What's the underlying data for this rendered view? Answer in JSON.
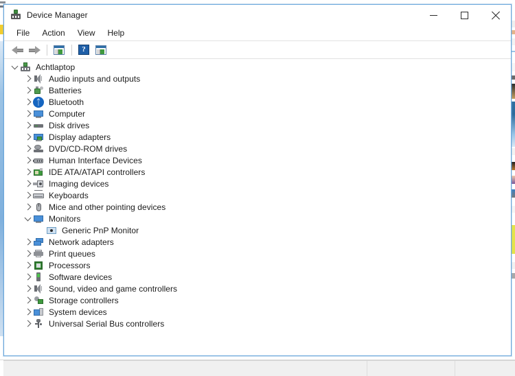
{
  "window": {
    "title": "Device Manager",
    "title_icon": "device-manager-icon",
    "controls": {
      "minimize": "minimize-button",
      "maximize": "maximize-button",
      "close": "close-button"
    },
    "accent_border": "#6ca8dc"
  },
  "menubar": {
    "items": [
      {
        "label": "File"
      },
      {
        "label": "Action"
      },
      {
        "label": "View"
      },
      {
        "label": "Help"
      }
    ]
  },
  "toolbar": {
    "buttons": [
      {
        "name": "back-button",
        "icon": "arrow-left-icon"
      },
      {
        "name": "forward-button",
        "icon": "arrow-right-icon"
      },
      {
        "name": "properties-button",
        "icon": "window-properties-icon"
      },
      {
        "name": "help-button",
        "icon": "help-question-icon"
      },
      {
        "name": "show-hidden-devices-button",
        "icon": "window-list-icon"
      }
    ]
  },
  "tree": {
    "root": {
      "label": "Achtlaptop",
      "icon": "computer-root-icon",
      "expanded": true
    },
    "items": [
      {
        "label": "Audio inputs and outputs",
        "icon": "speaker-icon",
        "expanded": false,
        "level": 1
      },
      {
        "label": "Batteries",
        "icon": "battery-icon",
        "expanded": false,
        "level": 1
      },
      {
        "label": "Bluetooth",
        "icon": "bluetooth-icon",
        "expanded": false,
        "level": 1
      },
      {
        "label": "Computer",
        "icon": "monitor-icon",
        "expanded": false,
        "level": 1
      },
      {
        "label": "Disk drives",
        "icon": "disk-drive-icon",
        "expanded": false,
        "level": 1
      },
      {
        "label": "Display adapters",
        "icon": "display-adapter-icon",
        "expanded": false,
        "level": 1
      },
      {
        "label": "DVD/CD-ROM drives",
        "icon": "dvd-drive-icon",
        "expanded": false,
        "level": 1
      },
      {
        "label": "Human Interface Devices",
        "icon": "hid-icon",
        "expanded": false,
        "level": 1
      },
      {
        "label": "IDE ATA/ATAPI controllers",
        "icon": "ide-controller-icon",
        "expanded": false,
        "level": 1
      },
      {
        "label": "Imaging devices",
        "icon": "imaging-device-icon",
        "expanded": false,
        "level": 1
      },
      {
        "label": "Keyboards",
        "icon": "keyboard-icon",
        "expanded": false,
        "level": 1
      },
      {
        "label": "Mice and other pointing devices",
        "icon": "mouse-icon",
        "expanded": false,
        "level": 1
      },
      {
        "label": "Monitors",
        "icon": "monitor-icon",
        "expanded": true,
        "level": 1
      },
      {
        "label": "Generic PnP Monitor",
        "icon": "pnp-monitor-icon",
        "expanded": null,
        "level": 2
      },
      {
        "label": "Network adapters",
        "icon": "network-adapter-icon",
        "expanded": false,
        "level": 1
      },
      {
        "label": "Print queues",
        "icon": "printer-icon",
        "expanded": false,
        "level": 1
      },
      {
        "label": "Processors",
        "icon": "cpu-icon",
        "expanded": false,
        "level": 1
      },
      {
        "label": "Software devices",
        "icon": "software-device-icon",
        "expanded": false,
        "level": 1
      },
      {
        "label": "Sound, video and game controllers",
        "icon": "speaker-icon",
        "expanded": false,
        "level": 1
      },
      {
        "label": "Storage controllers",
        "icon": "storage-controller-icon",
        "expanded": false,
        "level": 1
      },
      {
        "label": "System devices",
        "icon": "system-device-icon",
        "expanded": false,
        "level": 1
      },
      {
        "label": "Universal Serial Bus controllers",
        "icon": "usb-controller-icon",
        "expanded": false,
        "level": 1
      }
    ]
  },
  "statusbar": {
    "panes": [
      "",
      "",
      ""
    ]
  }
}
